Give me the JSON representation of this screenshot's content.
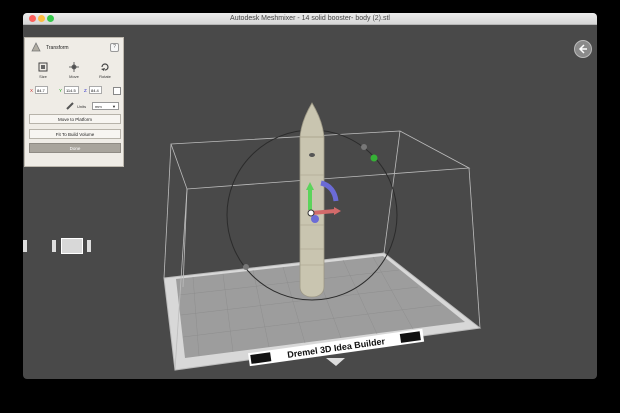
{
  "window": {
    "title": "Autodesk Meshmixer - 14 solid booster- body (2).stl"
  },
  "transform_panel": {
    "title": "Transform",
    "help": "?",
    "tools": [
      "Size",
      "Move",
      "Rotate"
    ],
    "xyz": [
      {
        "axis": "X",
        "value": "84.7"
      },
      {
        "axis": "Y",
        "value": "114.5"
      },
      {
        "axis": "Z",
        "value": "84.4"
      }
    ],
    "units_label": "Units",
    "units_value": "mm",
    "move_to_platform": "Move to Platform",
    "fit_to_build_volume": "Fit To Build Volume",
    "done": "Done"
  },
  "viewport": {
    "printer_label": "Dremel 3D Idea Builder"
  }
}
